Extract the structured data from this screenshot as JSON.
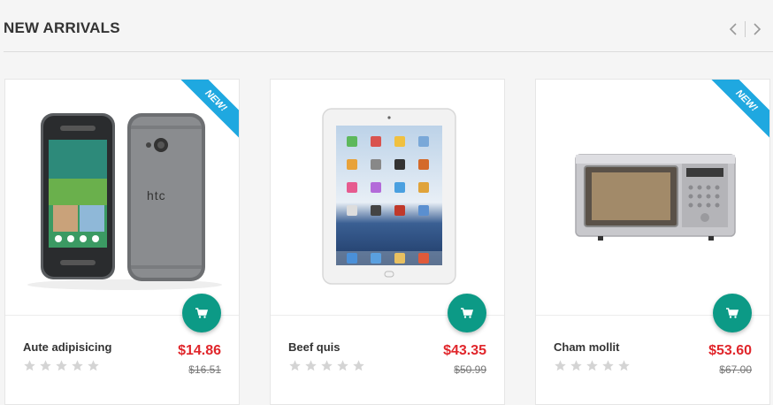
{
  "section": {
    "title": "NEW ARRIVALS",
    "prev_icon": "chevron-left-icon",
    "next_icon": "chevron-right-icon"
  },
  "colors": {
    "price": "#e0262b",
    "cart_button": "#0c9a86",
    "new_ribbon": "#1fa8e0",
    "star_empty": "#d4d4d4"
  },
  "products": [
    {
      "image": "htc-phone-image",
      "badge": "NEW!",
      "name": "Aute adipisicing",
      "price": "$14.86",
      "old_price": "$16.51",
      "rating": 0,
      "rating_max": 5,
      "cart_icon": "cart-icon"
    },
    {
      "image": "ipad-tablet-image",
      "badge": "",
      "name": "Beef quis",
      "price": "$43.35",
      "old_price": "$50.99",
      "rating": 0,
      "rating_max": 5,
      "cart_icon": "cart-icon"
    },
    {
      "image": "microwave-oven-image",
      "badge": "NEW!",
      "name": "Cham mollit",
      "price": "$53.60",
      "old_price": "$67.00",
      "rating": 0,
      "rating_max": 5,
      "cart_icon": "cart-icon"
    }
  ]
}
